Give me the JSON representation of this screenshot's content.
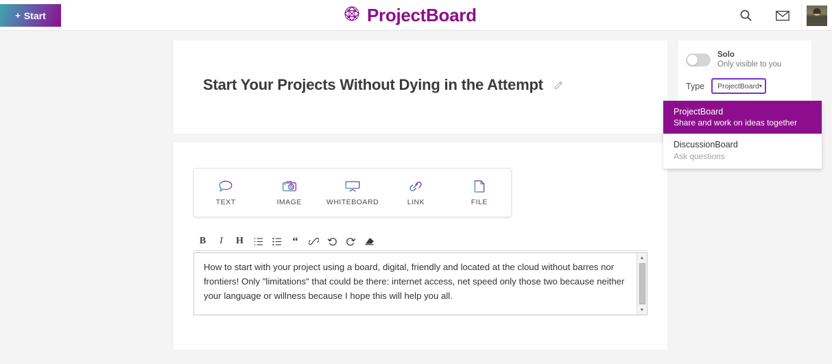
{
  "topbar": {
    "start_label": "Start",
    "start_plus": "+",
    "brand": "ProjectBoard",
    "brand_icon": "geodesic-sphere-icon",
    "search_icon": "search-icon",
    "mail_icon": "envelope-icon",
    "avatar_icon": "user-avatar"
  },
  "title_card": {
    "title": "Start Your Projects Without Dying in the Attempt",
    "edit_icon": "pencil-icon"
  },
  "content_types": [
    {
      "label": "TEXT",
      "icon": "speech-bubble-icon"
    },
    {
      "label": "IMAGE",
      "icon": "camera-icon"
    },
    {
      "label": "WHITEBOARD",
      "icon": "whiteboard-icon"
    },
    {
      "label": "LINK",
      "icon": "link-chain-icon"
    },
    {
      "label": "FILE",
      "icon": "file-add-icon"
    }
  ],
  "rich_text_toolbar": [
    {
      "label": "B",
      "name": "bold-button"
    },
    {
      "label": "I",
      "name": "italic-button"
    },
    {
      "label": "H",
      "name": "heading-button"
    },
    {
      "label": "",
      "name": "ordered-list-button"
    },
    {
      "label": "",
      "name": "unordered-list-button"
    },
    {
      "label": "“",
      "name": "blockquote-button"
    },
    {
      "label": "",
      "name": "link-button"
    },
    {
      "label": "",
      "name": "undo-button"
    },
    {
      "label": "",
      "name": "redo-button"
    },
    {
      "label": "",
      "name": "clear-format-button"
    }
  ],
  "editor": {
    "value": "How to start with your project using a board, digital, friendly and located at the cloud without barres nor frontiers! Only \"limitations\" that could be there: internet access, net speed only those two because neither your language or willness because I hope this will help you all.",
    "placeholder": "Write something..."
  },
  "right_panel": {
    "solo_title": "Solo",
    "solo_subtitle": "Only visible to you",
    "solo_state": "off",
    "type_label": "Type",
    "type_value": "ProjectBoard",
    "chevron": "▾"
  },
  "dropdown": {
    "options": [
      {
        "name": "ProjectBoard",
        "description": "Share and work on ideas together",
        "selected": true
      },
      {
        "name": "DiscussionBoard",
        "description": "Ask questions",
        "selected": false
      }
    ]
  },
  "colors": {
    "brand_purple": "#8d0e8d",
    "accent_teal": "#3fa6ad",
    "focus_violet": "#7b2fd4",
    "page_bg": "#f4f4f4"
  }
}
